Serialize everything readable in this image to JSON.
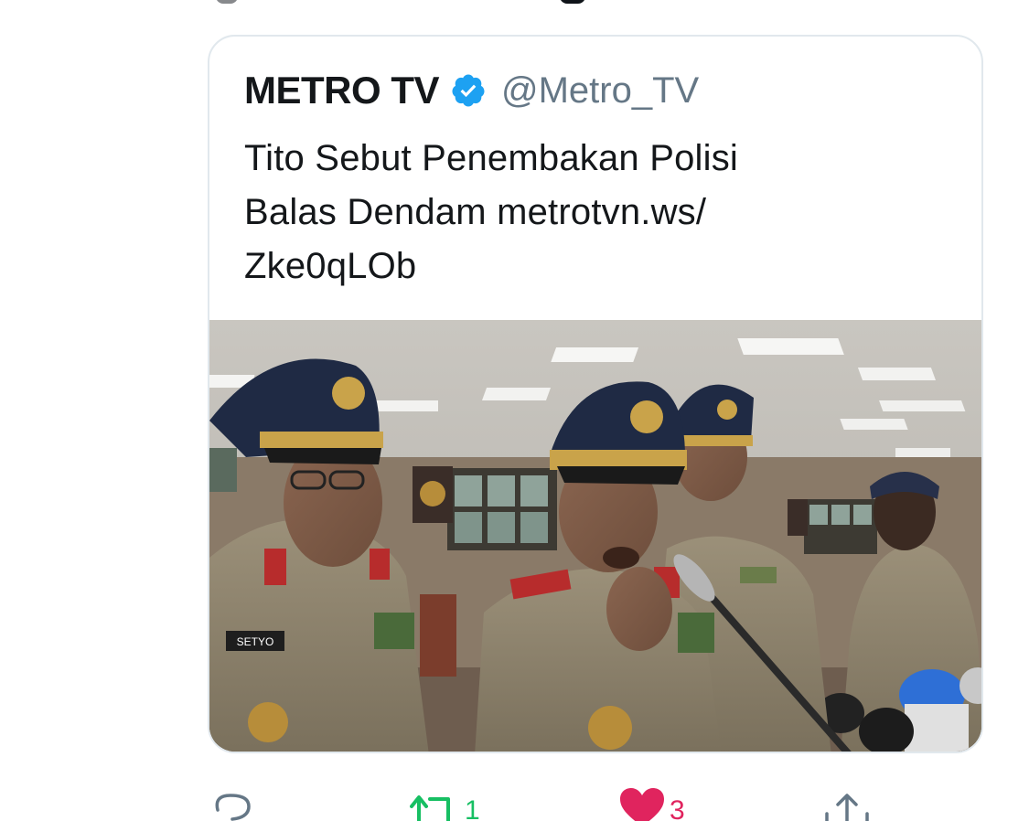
{
  "quoted_tweet": {
    "author_name": "METRO TV",
    "verified_icon": "verified-badge-icon",
    "author_handle": "@Metro_TV",
    "text_lines": [
      "Tito Sebut Penembakan Polisi",
      "Balas Dendam metrotvn.ws/",
      "Zke0qLOb"
    ],
    "media": {
      "nametag_text": "SETYO"
    }
  },
  "actions": {
    "reply_icon": "reply-icon",
    "retweet_icon": "retweet-icon",
    "retweet_count": "1",
    "like_icon": "heart-filled-icon",
    "like_count": "3",
    "share_icon": "share-icon"
  },
  "colors": {
    "verified": "#1da1f2",
    "retweet_active": "#17bf63",
    "like_active": "#e0245e",
    "text": "#14171a",
    "secondary": "#657786",
    "border": "#e1e8ed"
  }
}
